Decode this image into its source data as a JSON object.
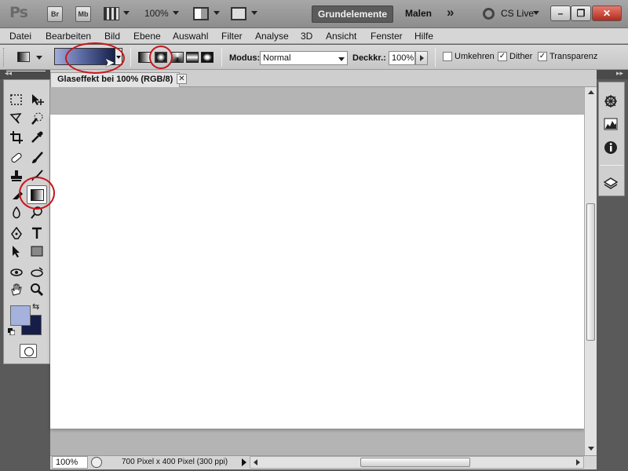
{
  "app": {
    "logo": "Ps",
    "bridge_label": "Br",
    "minibridge_label": "Mb",
    "zoom": "100%"
  },
  "workspaces": {
    "active": "Grundelemente",
    "other": "Malen",
    "more": "»",
    "cs_live": "CS Live"
  },
  "window_controls": {
    "minimize": "–",
    "restore": "❐",
    "close": "✕"
  },
  "menu": [
    "Datei",
    "Bearbeiten",
    "Bild",
    "Ebene",
    "Auswahl",
    "Filter",
    "Analyse",
    "3D",
    "Ansicht",
    "Fenster",
    "Hilfe"
  ],
  "options": {
    "modus_label": "Modus:",
    "modus_value": "Normal",
    "deckkraft_label": "Deckkr.:",
    "deckkraft_value": "100%",
    "umkehren_label": "Umkehren",
    "umkehren_checked": false,
    "dither_label": "Dither",
    "dither_checked": true,
    "transparenz_label": "Transparenz",
    "transparenz_checked": true,
    "gradient_colors": [
      "#a0acda",
      "#5b6aa3",
      "#16204a"
    ],
    "gradient_types": [
      "linear",
      "radial",
      "angle",
      "reflected",
      "diamond"
    ],
    "selected_gradient_type": "radial"
  },
  "document": {
    "tab_title": "Glaseffekt bei 100% (RGB/8)",
    "close_glyph": "✕",
    "zoom_field": "100%",
    "info": "700 Pixel x 400 Pixel (300 ppi)"
  },
  "colors": {
    "foreground": "#a4b2dd",
    "background": "#161d47",
    "annotation": "#c8161c"
  },
  "tools": [
    "marquee-tool",
    "move-tool",
    "lasso-tool",
    "quick-selection-tool",
    "crop-tool",
    "eyedropper-tool",
    "healing-brush-tool",
    "brush-tool",
    "clone-stamp-tool",
    "history-brush-tool",
    "eraser-tool",
    "gradient-tool",
    "blur-tool",
    "dodge-tool",
    "pen-tool",
    "type-tool",
    "path-selection-tool",
    "rectangle-tool",
    "3d-rotate-tool",
    "3d-orbit-tool",
    "hand-tool",
    "zoom-tool"
  ],
  "right_panel": [
    "navigator-icon",
    "histogram-icon",
    "info-icon",
    "layers-icon"
  ],
  "toggle_glyphs": {
    "left": "◂◂",
    "right": "▸▸",
    "swap": "⇆"
  }
}
